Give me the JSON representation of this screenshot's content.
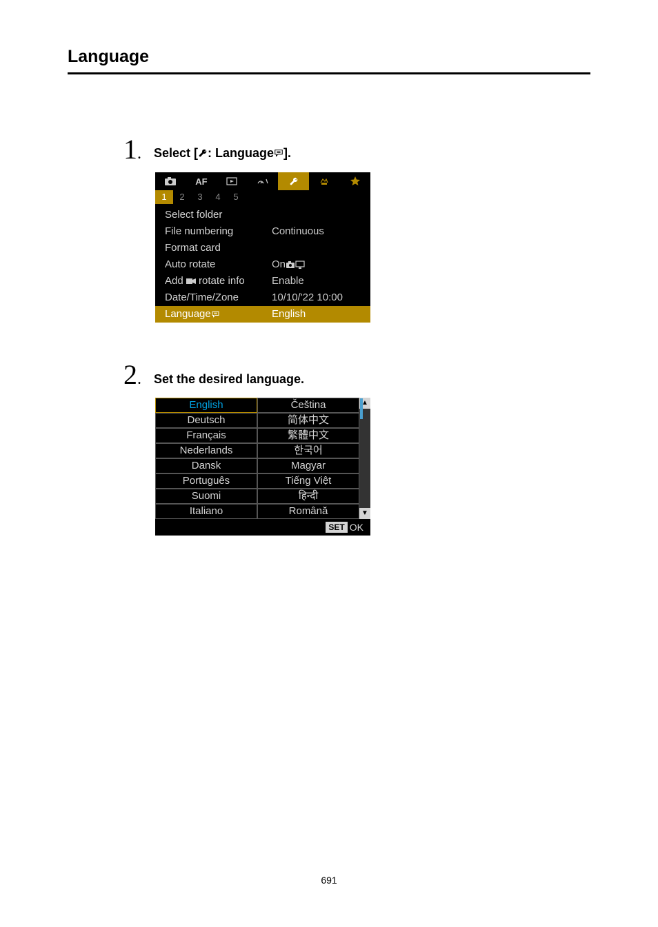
{
  "page": {
    "title": "Language",
    "number": "691"
  },
  "step1": {
    "num": "1",
    "dot": ".",
    "prefix": "Select [",
    "mid": ": Language",
    "suffix": "].",
    "pageTabs": [
      "1",
      "2",
      "3",
      "4",
      "5"
    ],
    "menu": {
      "selectFolder": "Select folder",
      "fileNumbering": "File numbering",
      "fileNumberingVal": "Continuous",
      "formatCard": "Format card",
      "autoRotate": "Auto rotate",
      "autoRotateVal": "On",
      "addRotateInfo": "Add    rotate info",
      "addRotateInfoVal": "Enable",
      "dateTimeZone": "Date/Time/Zone",
      "dateTimeZoneVal": "10/10/'22 10:00",
      "language": "Language",
      "languageVal": "English"
    }
  },
  "step2": {
    "num": "2",
    "dot": ".",
    "label": "Set the desired language.",
    "langsCol1": [
      "English",
      "Deutsch",
      "Français",
      "Nederlands",
      "Dansk",
      "Português",
      "Suomi",
      "Italiano"
    ],
    "langsCol2": [
      "Čeština",
      "简体中文",
      "繁體中文",
      "한국어",
      "Magyar",
      "Tiếng Việt",
      "हिन्दी",
      "Română"
    ],
    "setLabel": "SET",
    "okLabel": "OK"
  }
}
